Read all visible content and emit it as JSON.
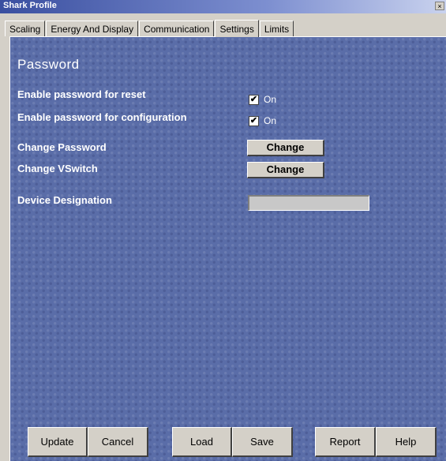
{
  "window": {
    "title": "Shark Profile",
    "close_glyph": "×"
  },
  "tabs": [
    {
      "label": "Scaling",
      "active": false
    },
    {
      "label": "Energy And Display",
      "active": false
    },
    {
      "label": "Communication",
      "active": false
    },
    {
      "label": "Settings",
      "active": true
    },
    {
      "label": "Limits",
      "active": false
    }
  ],
  "settings": {
    "section_title": "Password",
    "reset_password": {
      "label": "Enable password for reset",
      "checked": true,
      "state_label": "On"
    },
    "config_password": {
      "label": "Enable password for configuration",
      "checked": true,
      "state_label": "On"
    },
    "change_password": {
      "label": "Change Password",
      "button": "Change"
    },
    "change_vswitch": {
      "label": "Change VSwitch",
      "button": "Change"
    },
    "device_designation": {
      "label": "Device Designation",
      "value": ""
    }
  },
  "buttons": {
    "update": "Update",
    "cancel": "Cancel",
    "load": "Load",
    "save": "Save",
    "report": "Report",
    "help": "Help"
  },
  "colors": {
    "panel_background": "#5a6da8",
    "title_bar": "#3a4fa0"
  }
}
